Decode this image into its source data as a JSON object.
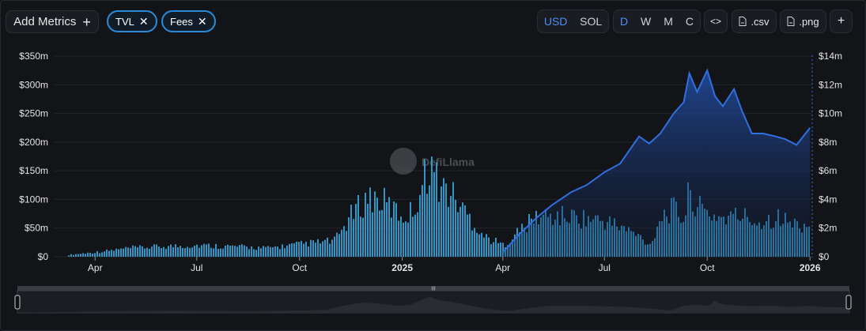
{
  "toolbar": {
    "add_metrics_label": "Add Metrics",
    "add_icon": "plus-icon",
    "metric_pills": [
      {
        "label": "TVL",
        "remove_icon": "close-icon"
      },
      {
        "label": "Fees",
        "remove_icon": "close-icon"
      }
    ],
    "currency_options": [
      "USD",
      "SOL"
    ],
    "currency_selected": "USD",
    "interval_options": [
      "D",
      "W",
      "M",
      "C"
    ],
    "interval_selected": "D",
    "embed_icon": "code-icon",
    "csv_label": ".csv",
    "png_label": ".png",
    "file_icon": "file-icon",
    "more_icon": "plus-icon"
  },
  "watermark": {
    "text": "DefiLlama",
    "icon": "llama-logo-icon"
  },
  "range_selector": {
    "handle_icon": "grip-icon",
    "left_handle": "range-handle-left",
    "right_handle": "range-handle-right"
  },
  "colors": {
    "tvl_line": "#2f6fe0",
    "fees_bars": "#35a3d9",
    "accent": "#4c8ef7",
    "pill_border": "#2a8ad8"
  },
  "chart_data": {
    "type": "bar",
    "title": "",
    "xlabel": "",
    "x_ticks": [
      "Apr",
      "Jul",
      "Oct",
      "2025",
      "Apr",
      "Jul",
      "Oct",
      "2026"
    ],
    "left_axis": {
      "label": "",
      "ticks": [
        "$0",
        "$50m",
        "$100m",
        "$150m",
        "$200m",
        "$250m",
        "$300m",
        "$350m"
      ],
      "ylim": [
        0,
        350
      ]
    },
    "right_axis": {
      "label": "",
      "ticks": [
        "$0",
        "$2m",
        "$4m",
        "$6m",
        "$8m",
        "$10m",
        "$12m",
        "$14m"
      ],
      "ylim": [
        0,
        14
      ]
    },
    "grid": true,
    "series": [
      {
        "name": "TVL",
        "type": "area",
        "axis": "right",
        "unit": "$m",
        "x": [
          "2025-04-01",
          "2025-04-15",
          "2025-05-01",
          "2025-05-15",
          "2025-06-01",
          "2025-06-15",
          "2025-07-01",
          "2025-07-15",
          "2025-08-01",
          "2025-08-10",
          "2025-08-20",
          "2025-09-01",
          "2025-09-10",
          "2025-09-15",
          "2025-09-22",
          "2025-10-01",
          "2025-10-08",
          "2025-10-15",
          "2025-10-25",
          "2025-11-01",
          "2025-11-10",
          "2025-11-20",
          "2025-12-01",
          "2025-12-10",
          "2025-12-20",
          "2026-01-01"
        ],
        "values": [
          0.3,
          1.5,
          2.7,
          3.6,
          4.5,
          5.0,
          5.9,
          6.5,
          8.4,
          7.9,
          8.6,
          10.0,
          10.8,
          12.8,
          11.5,
          13.0,
          11.2,
          10.5,
          11.7,
          10.2,
          8.6,
          8.6,
          8.4,
          8.2,
          7.8,
          9.0
        ]
      },
      {
        "name": "Fees",
        "type": "bar",
        "axis": "left",
        "unit": "$m",
        "x": [
          "2024-03-01",
          "2024-04-01",
          "2024-05-01",
          "2024-06-01",
          "2024-07-01",
          "2024-08-01",
          "2024-09-01",
          "2024-10-01",
          "2024-11-01",
          "2024-11-15",
          "2024-12-01",
          "2024-12-15",
          "2025-01-01",
          "2025-01-10",
          "2025-01-15",
          "2025-01-25",
          "2025-02-01",
          "2025-02-15",
          "2025-03-01",
          "2025-03-15",
          "2025-04-01",
          "2025-04-15",
          "2025-05-01",
          "2025-06-01",
          "2025-07-01",
          "2025-07-15",
          "2025-08-01",
          "2025-08-10",
          "2025-08-20",
          "2025-09-01",
          "2025-09-10",
          "2025-09-15",
          "2025-09-20",
          "2025-10-01",
          "2025-10-15",
          "2025-11-01",
          "2025-11-15",
          "2025-12-01",
          "2025-12-15",
          "2026-01-01"
        ],
        "values": [
          2,
          8,
          15,
          18,
          20,
          18,
          15,
          22,
          28,
          70,
          105,
          95,
          70,
          80,
          108,
          165,
          130,
          105,
          70,
          35,
          20,
          45,
          70,
          70,
          62,
          52,
          35,
          20,
          72,
          83,
          65,
          125,
          88,
          75,
          68,
          72,
          60,
          70,
          58,
          55
        ]
      }
    ]
  }
}
